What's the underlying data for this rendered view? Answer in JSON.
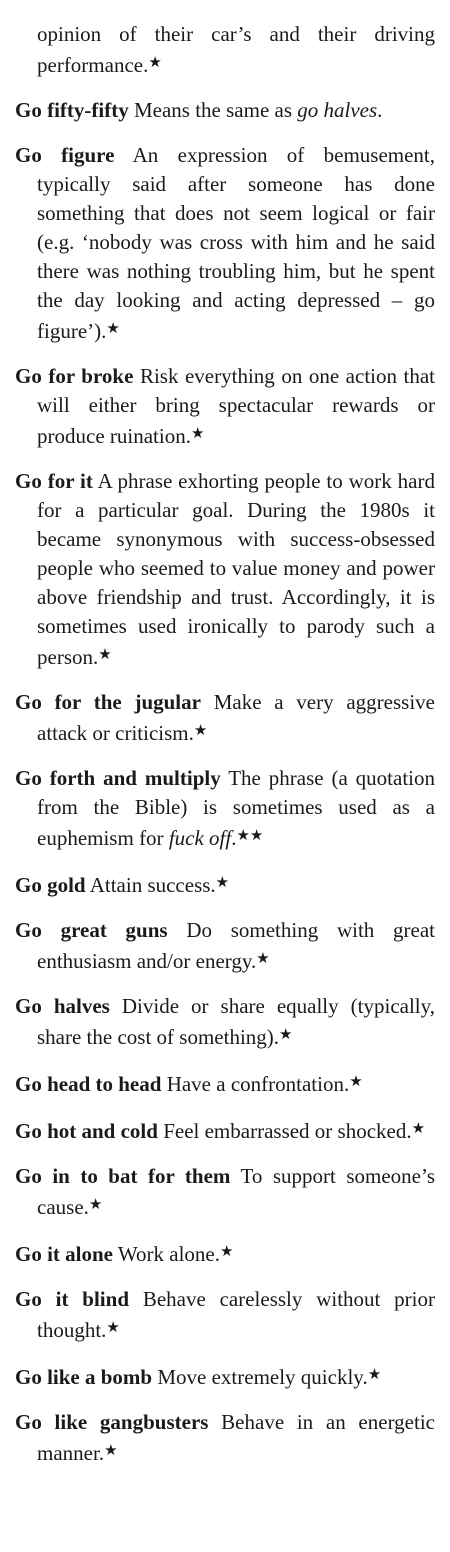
{
  "entries": [
    {
      "term": "",
      "def": "opinion of their car’s and their driving performance.",
      "xref": "",
      "after": "",
      "stars": "★"
    },
    {
      "term": "Go fifty-fifty",
      "def": " Means the same as ",
      "xref": "go halves",
      "after": ".",
      "stars": ""
    },
    {
      "term": "Go figure",
      "def": " An expression of bemusement, typically said after someone has done something that does not seem logical or fair (e.g. ‘nobody was cross with him and he said there was nothing troubling him, but he spent the day looking and acting depressed – go figure’).",
      "xref": "",
      "after": "",
      "stars": "★"
    },
    {
      "term": "Go for broke",
      "def": " Risk everything on one action that will either bring spectacular rewards or produce ruination.",
      "xref": "",
      "after": "",
      "stars": "★"
    },
    {
      "term": "Go for it",
      "def": " A phrase exhorting people to work hard for a particular goal. During the 1980s it became synonymous with success-obsessed people who seemed to value money and power above friendship and trust. Accordingly, it is sometimes used ironically to parody such a person.",
      "xref": "",
      "after": "",
      "stars": "★"
    },
    {
      "term": "Go for the jugular",
      "def": " Make a very aggressive attack or criticism.",
      "xref": "",
      "after": "",
      "stars": "★"
    },
    {
      "term": "Go forth and multiply",
      "def": " The phrase (a quo­tation from the Bible) is sometimes used as a euphemism for ",
      "xref": "fuck off",
      "after": ".",
      "stars": "★★"
    },
    {
      "term": "Go gold",
      "def": " Attain success.",
      "xref": "",
      "after": "",
      "stars": "★"
    },
    {
      "term": "Go great guns",
      "def": " Do something with great enthusiasm and/or energy.",
      "xref": "",
      "after": "",
      "stars": "★"
    },
    {
      "term": "Go halves",
      "def": " Divide or share equally (typi­cally, share the cost of something).",
      "xref": "",
      "after": "",
      "stars": "★"
    },
    {
      "term": "Go head to head",
      "def": " Have a confrontation.",
      "xref": "",
      "after": "",
      "stars": "★"
    },
    {
      "term": "Go hot and cold",
      "def": " Feel embarrassed or shocked.",
      "xref": "",
      "after": "",
      "stars": "★"
    },
    {
      "term": "Go in to bat for them",
      "def": " To support some­one’s cause.",
      "xref": "",
      "after": "",
      "stars": "★"
    },
    {
      "term": "Go it alone",
      "def": " Work alone.",
      "xref": "",
      "after": "",
      "stars": "★"
    },
    {
      "term": "Go it blind",
      "def": " Behave carelessly without prior thought.",
      "xref": "",
      "after": "",
      "stars": "★"
    },
    {
      "term": "Go like a bomb",
      "def": " Move extremely quickly.",
      "xref": "",
      "after": "",
      "stars": "★"
    },
    {
      "term": "Go like gangbusters",
      "def": " Behave in an ener­getic manner.",
      "xref": "",
      "after": "",
      "stars": "★"
    }
  ]
}
